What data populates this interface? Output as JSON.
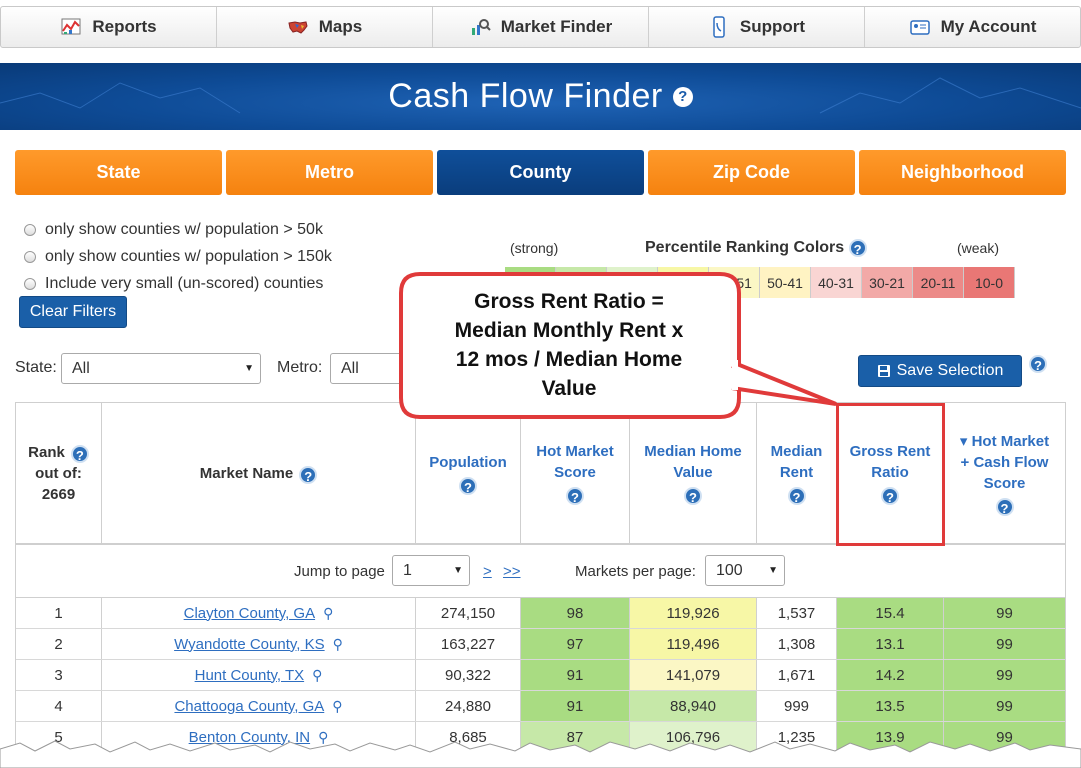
{
  "nav": {
    "items": [
      {
        "label": "Reports",
        "icon": "reports-chart-icon"
      },
      {
        "label": "Maps",
        "icon": "us-map-icon"
      },
      {
        "label": "Market Finder",
        "icon": "market-finder-icon"
      },
      {
        "label": "Support",
        "icon": "phone-support-icon"
      },
      {
        "label": "My Account",
        "icon": "account-card-icon"
      }
    ]
  },
  "banner": {
    "title": "Cash Flow Finder",
    "help": "?"
  },
  "tabs": [
    {
      "label": "State",
      "active": false
    },
    {
      "label": "Metro",
      "active": false
    },
    {
      "label": "County",
      "active": true
    },
    {
      "label": "Zip Code",
      "active": false
    },
    {
      "label": "Neighborhood",
      "active": false
    }
  ],
  "filters": {
    "options": [
      "only show counties w/ population > 50k",
      "only show counties w/ population > 150k",
      "Include very small (un-scored) counties"
    ],
    "clear_label": "Clear Filters"
  },
  "legend": {
    "strong": "(strong)",
    "title": "Percentile Ranking Colors",
    "weak": "(weak)",
    "cells": [
      {
        "label": "",
        "color": "#a9dc82"
      },
      {
        "label": "",
        "color": "#c6e8a8"
      },
      {
        "label": "",
        "color": "#dff2cb"
      },
      {
        "label": "",
        "color": "#f7f7a6"
      },
      {
        "label": "60-51",
        "color": "#fbf7c5"
      },
      {
        "label": "50-41",
        "color": "#fff3c3"
      },
      {
        "label": "40-31",
        "color": "#f9d5d3"
      },
      {
        "label": "30-21",
        "color": "#f2a9a7"
      },
      {
        "label": "20-11",
        "color": "#ec8a88"
      },
      {
        "label": "10-0",
        "color": "#e97775"
      }
    ]
  },
  "selectors": {
    "state_label": "State:",
    "state_value": "All",
    "metro_label": "Metro:",
    "metro_value": "All",
    "save_label": "Save Selection"
  },
  "callout": {
    "lines": [
      "Gross Rent Ratio =",
      "Median Monthly Rent x",
      "12 mos / Median Home",
      "Value"
    ]
  },
  "table": {
    "headers": {
      "rank": [
        "Rank",
        "out of:",
        "2669"
      ],
      "market_name": "Market Name",
      "population": "Population",
      "hot_market": [
        "Hot Market",
        "Score"
      ],
      "median_home": [
        "Median Home",
        "Value"
      ],
      "median_rent": [
        "Median",
        "Rent"
      ],
      "gross_rent": [
        "Gross Rent",
        "Ratio"
      ],
      "hot_cash": [
        "▾ Hot Market",
        "+ Cash Flow",
        "Score"
      ]
    },
    "pager": {
      "jump_label": "Jump to page",
      "page_value": "1",
      "next": ">",
      "last": ">>",
      "per_page_label": "Markets per page:",
      "per_page_value": "100"
    },
    "rows": [
      {
        "rank": "1",
        "name": "Clayton County, GA",
        "population": "274,150",
        "hot": "98",
        "home": "119,926",
        "rent": "1,537",
        "grr": "15.4",
        "score": "99",
        "hot_color": "#a9dc82",
        "home_color": "#f7f7a6",
        "grr_color": "#a9dc82",
        "score_color": "#a9dc82"
      },
      {
        "rank": "2",
        "name": "Wyandotte County, KS",
        "population": "163,227",
        "hot": "97",
        "home": "119,496",
        "rent": "1,308",
        "grr": "13.1",
        "score": "99",
        "hot_color": "#a9dc82",
        "home_color": "#f7f7a6",
        "grr_color": "#a9dc82",
        "score_color": "#a9dc82"
      },
      {
        "rank": "3",
        "name": "Hunt County, TX",
        "population": "90,322",
        "hot": "91",
        "home": "141,079",
        "rent": "1,671",
        "grr": "14.2",
        "score": "99",
        "hot_color": "#a9dc82",
        "home_color": "#fbf7c5",
        "grr_color": "#a9dc82",
        "score_color": "#a9dc82"
      },
      {
        "rank": "4",
        "name": "Chattooga County, GA",
        "population": "24,880",
        "hot": "91",
        "home": "88,940",
        "rent": "999",
        "grr": "13.5",
        "score": "99",
        "hot_color": "#a9dc82",
        "home_color": "#c6e8a8",
        "grr_color": "#a9dc82",
        "score_color": "#a9dc82"
      },
      {
        "rank": "5",
        "name": "Benton County, IN",
        "population": "8,685",
        "hot": "87",
        "home": "106,796",
        "rent": "1,235",
        "grr": "13.9",
        "score": "99",
        "hot_color": "#c6e8a8",
        "home_color": "#dff2cb",
        "grr_color": "#a9dc82",
        "score_color": "#a9dc82"
      }
    ]
  }
}
